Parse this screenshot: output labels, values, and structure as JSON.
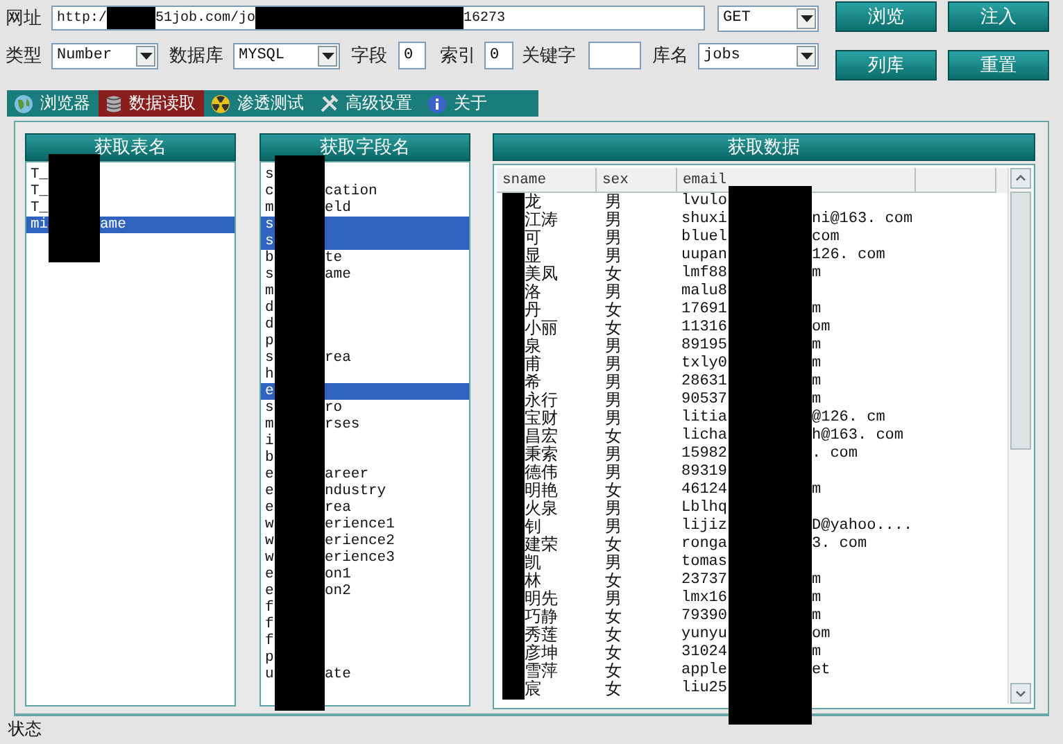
{
  "address": {
    "label": "网址",
    "url_parts": [
      "http:/",
      "51job.com/jo",
      "16273"
    ]
  },
  "method": {
    "value": "GET"
  },
  "buttons": [
    "浏览",
    "注入",
    "列库",
    "重置"
  ],
  "options": [
    {
      "kind": "select",
      "label": "类型",
      "value": "Number"
    },
    {
      "kind": "select",
      "label": "数据库",
      "value": "MYSQL"
    },
    {
      "kind": "input",
      "label": "字段",
      "value": "0"
    },
    {
      "kind": "input",
      "label": "索引",
      "value": "0"
    },
    {
      "kind": "input",
      "label": "关键字"
    },
    {
      "kind": "select",
      "label": "库名",
      "value": "jobs"
    }
  ],
  "tabs": [
    {
      "label": "浏览器",
      "selected": false
    },
    {
      "label": "数据读取",
      "selected": true
    },
    {
      "label": "渗透测试",
      "selected": false
    },
    {
      "label": "高级设置",
      "selected": false
    },
    {
      "label": "关于",
      "selected": false
    }
  ],
  "tables": {
    "title": "获取表名",
    "items": [
      {
        "start": "T_",
        "selected": false
      },
      {
        "start": "T_",
        "selected": false
      },
      {
        "start": "T_",
        "selected": false
      },
      {
        "start": "mi",
        "end": "ame",
        "selected": true
      }
    ]
  },
  "fields": {
    "title": "获取字段名",
    "items": [
      {
        "start": "s",
        "selected": false
      },
      {
        "start": "c",
        "end": "cation",
        "selected": false
      },
      {
        "start": "m",
        "end": "eld",
        "selected": false
      },
      {
        "start": "s",
        "selected": true
      },
      {
        "start": "s",
        "selected": true
      },
      {
        "start": "b",
        "end": "te",
        "selected": false
      },
      {
        "start": "s",
        "end": "ame",
        "selected": false
      },
      {
        "start": "m",
        "selected": false
      },
      {
        "start": "d",
        "selected": false
      },
      {
        "start": "d",
        "selected": false
      },
      {
        "start": "p",
        "selected": false
      },
      {
        "start": "s",
        "end": "rea",
        "selected": false
      },
      {
        "start": "h",
        "selected": false
      },
      {
        "start": "e",
        "selected": true
      },
      {
        "start": "s",
        "end": "ro",
        "selected": false
      },
      {
        "start": "m",
        "end": "rses",
        "selected": false
      },
      {
        "start": "i",
        "selected": false
      },
      {
        "start": "b",
        "selected": false
      },
      {
        "start": "e",
        "end": "areer",
        "selected": false
      },
      {
        "start": "e",
        "end": "ndustry",
        "selected": false
      },
      {
        "start": "e",
        "end": "rea",
        "selected": false
      },
      {
        "start": "w",
        "end": "erience1",
        "selected": false
      },
      {
        "start": "w",
        "end": "erience2",
        "selected": false
      },
      {
        "start": "w",
        "end": "erience3",
        "selected": false
      },
      {
        "start": "e",
        "end": "on1",
        "selected": false
      },
      {
        "start": "e",
        "end": "on2",
        "selected": false
      },
      {
        "start": "f",
        "selected": false
      },
      {
        "start": "f",
        "selected": false
      },
      {
        "start": "f",
        "selected": false
      },
      {
        "start": "p",
        "selected": false
      },
      {
        "start": "u",
        "end": "ate",
        "selected": false
      }
    ]
  },
  "data": {
    "title": "获取数据",
    "columns": [
      "sname",
      "sex",
      "email"
    ],
    "rows": [
      {
        "sname": "龙",
        "sex": "男",
        "email_start": "lvulo"
      },
      {
        "sname": "江涛",
        "sex": "男",
        "email_start": "shuxi",
        "email_end": "ni@163. com"
      },
      {
        "sname": "可",
        "sex": "男",
        "email_start": "bluel",
        "email_end": "com"
      },
      {
        "sname": "显",
        "sex": "男",
        "email_start": "uupan",
        "email_end": "126. com"
      },
      {
        "sname": "美凤",
        "sex": "女",
        "email_start": "lmf88",
        "email_end": "m"
      },
      {
        "sname": "洛",
        "sex": "男",
        "email_start": "malu8"
      },
      {
        "sname": "丹",
        "sex": "女",
        "email_start": "17691",
        "email_end": "m"
      },
      {
        "sname": "小丽",
        "sex": "女",
        "email_start": "11316",
        "email_end": "om"
      },
      {
        "sname": "泉",
        "sex": "男",
        "email_start": "89195",
        "email_end": "m"
      },
      {
        "sname": "甫",
        "sex": "男",
        "email_start": "txly0",
        "email_end": "m"
      },
      {
        "sname": "希",
        "sex": "男",
        "email_start": "28631",
        "email_end": "m"
      },
      {
        "sname": "永行",
        "sex": "男",
        "email_start": "90537",
        "email_end": "m"
      },
      {
        "sname": "宝财",
        "sex": "男",
        "email_start": "litia",
        "email_end": "@126. cm"
      },
      {
        "sname": "昌宏",
        "sex": "女",
        "email_start": "licha",
        "email_end": "h@163. com"
      },
      {
        "sname": "秉索",
        "sex": "男",
        "email_start": "15982",
        "email_end": ". com"
      },
      {
        "sname": "德伟",
        "sex": "男",
        "email_start": "89319"
      },
      {
        "sname": "明艳",
        "sex": "女",
        "email_start": "46124",
        "email_end": "m"
      },
      {
        "sname": "火泉",
        "sex": "男",
        "email_start": "Lblhq"
      },
      {
        "sname": "钊",
        "sex": "男",
        "email_start": "lijiz",
        "email_end": "D@yahoo...."
      },
      {
        "sname": "建荣",
        "sex": "女",
        "email_start": "ronga",
        "email_end": "3. com"
      },
      {
        "sname": "凯",
        "sex": "男",
        "email_start": "tomas"
      },
      {
        "sname": "林",
        "sex": "女",
        "email_start": "23737",
        "email_end": "m"
      },
      {
        "sname": "明先",
        "sex": "男",
        "email_start": "lmx16",
        "email_end": "m"
      },
      {
        "sname": "巧静",
        "sex": "女",
        "email_start": "79390",
        "email_end": "m"
      },
      {
        "sname": "秀莲",
        "sex": "女",
        "email_start": "yunyu",
        "email_end": "om"
      },
      {
        "sname": "彦坤",
        "sex": "女",
        "email_start": "31024",
        "email_end": "m"
      },
      {
        "sname": "雪萍",
        "sex": "女",
        "email_start": "apple",
        "email_end": "et"
      },
      {
        "sname": "宸",
        "sex": "女",
        "email_start": "liu25"
      }
    ]
  },
  "status_bar": "状态"
}
